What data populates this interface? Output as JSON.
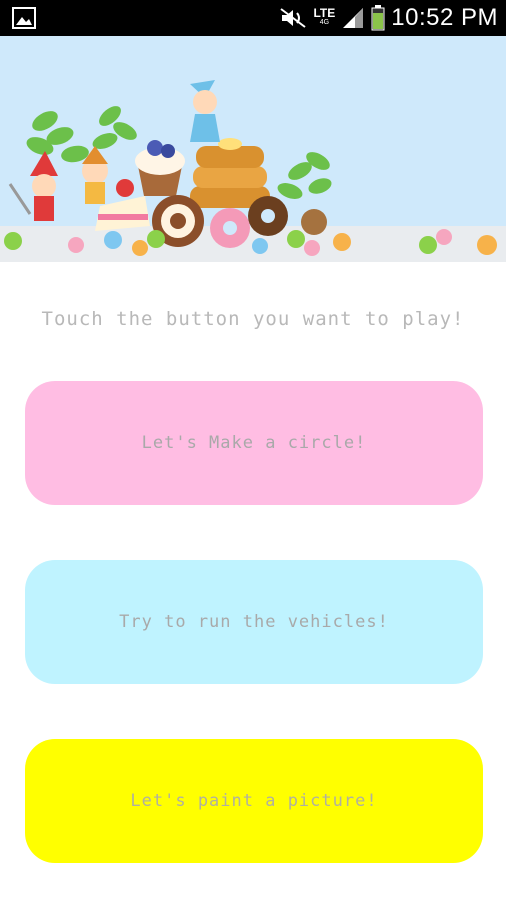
{
  "status_bar": {
    "time": "10:52 PM",
    "network": "LTE",
    "network_sub": "4G",
    "icons": [
      "image-icon",
      "mute-icon",
      "signal-icon",
      "battery-icon"
    ]
  },
  "banner": {
    "background": "#cfe9fb"
  },
  "prompt": "Touch the button you want to play!",
  "buttons": {
    "circle": {
      "label": "Let's Make a circle!",
      "color": "#ffbde3"
    },
    "vehicles": {
      "label": "Try to run the vehicles!",
      "color": "#bff3ff"
    },
    "paint": {
      "label": "Let's paint a picture!",
      "color": "#ffff00"
    }
  }
}
